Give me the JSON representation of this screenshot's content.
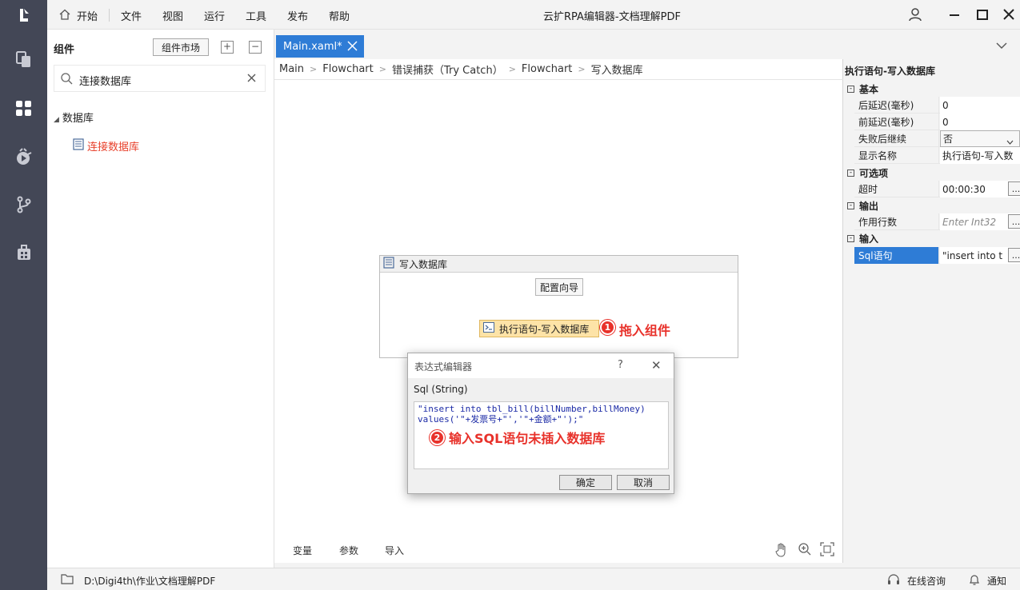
{
  "app": {
    "window_title": "云扩RPA编辑器-文档理解PDF"
  },
  "menu": {
    "items": [
      "开始",
      "文件",
      "视图",
      "运行",
      "工具",
      "发布",
      "帮助"
    ]
  },
  "left_panel": {
    "title": "组件",
    "market_button": "组件市场",
    "expand_label": "+",
    "collapse_label": "−",
    "search_value": "连接数据库",
    "tree_category": "数据库",
    "tree_item": "连接数据库"
  },
  "tabs": {
    "active_tab": "Main.xaml*"
  },
  "breadcrumb": [
    "Main",
    "Flowchart",
    "错误捕获（Try Catch）",
    "Flowchart",
    "写入数据库"
  ],
  "activity": {
    "title": "写入数据库",
    "config_button": "配置向导",
    "exec_node": "执行语句-写入数据库"
  },
  "annotations": {
    "a1_num": "1",
    "a1_text": "拖入组件",
    "a2_num": "2",
    "a2_text": "输入SQL语句未插入数据库"
  },
  "dialog": {
    "title": "表达式编辑器",
    "help": "?",
    "close": "✕",
    "label": "Sql (String)",
    "code_line1": "\"insert into tbl_bill(billNumber,billMoney)",
    "code_line2": "values('\"+发票号+\"','\"+金额+\"');\"",
    "ok": "确定",
    "cancel": "取消"
  },
  "bottom_tabs": [
    "变量",
    "参数",
    "导入"
  ],
  "properties": {
    "title": "执行语句-写入数据库",
    "sections": {
      "basic": "基本",
      "optional": "可选项",
      "output": "输出",
      "input": "输入"
    },
    "rows": {
      "delay_after_name": "后延迟(毫秒)",
      "delay_after_value": "0",
      "delay_before_name": "前延迟(毫秒)",
      "delay_before_value": "0",
      "continue_name": "失败后继续",
      "continue_value": "否",
      "display_name": "显示名称",
      "display_value": "执行语句-写入数",
      "timeout_name": "超时",
      "timeout_value": "00:00:30",
      "affected_name": "作用行数",
      "affected_placeholder": "Enter Int32",
      "sql_name": "Sql语句",
      "sql_value": "\"insert into t"
    },
    "ellipsis": "..."
  },
  "status": {
    "path": "D:\\Digi4th\\作业\\文档理解PDF",
    "consult": "在线咨询",
    "notify": "通知"
  },
  "colors": {
    "sidebar": "#434756",
    "accent": "#2e7cd6",
    "annotation_red": "#e8312a",
    "activity_node": "#fde3a7"
  }
}
